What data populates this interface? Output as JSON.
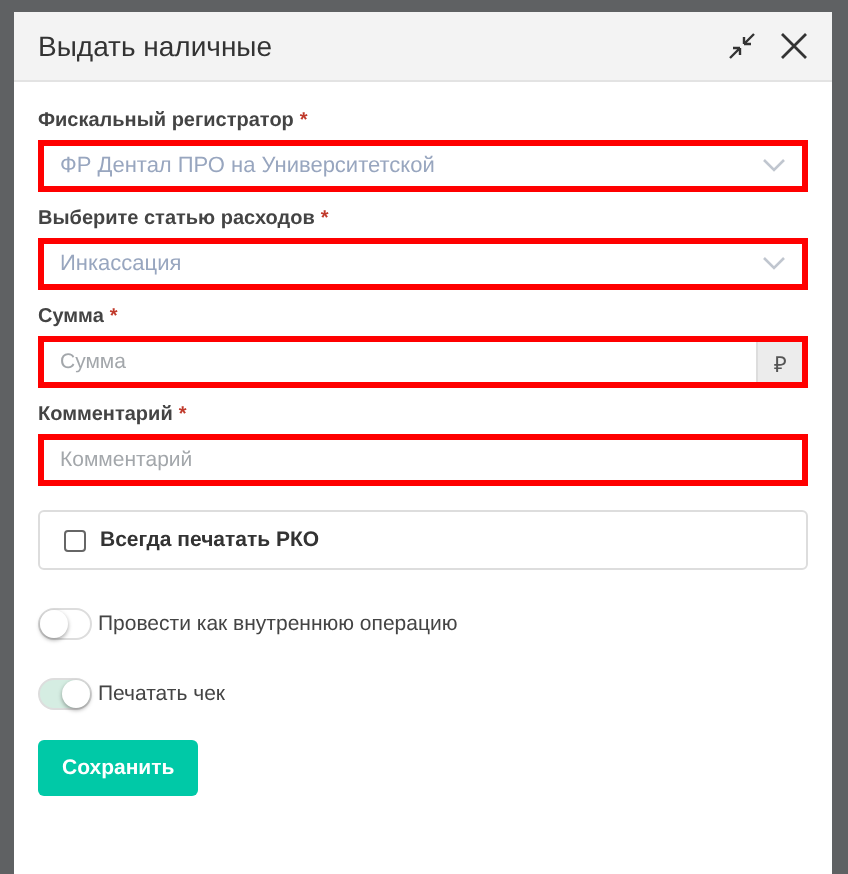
{
  "dialog": {
    "title": "Выдать наличные"
  },
  "fields": [
    {
      "kind": "select",
      "label": "Фискальный регистратор",
      "required_mark": "*",
      "value": "ФР Дентал ПРО на Университетской",
      "highlighted": true
    },
    {
      "kind": "select",
      "label": "Выберите статью расходов",
      "required_mark": "*",
      "value": "Инкассация",
      "highlighted": true
    },
    {
      "kind": "money",
      "label": "Сумма",
      "required_mark": "*",
      "placeholder": "Сумма",
      "suffix": "₽",
      "highlighted": true
    },
    {
      "kind": "text",
      "label": "Комментарий",
      "required_mark": "*",
      "placeholder": "Комментарий",
      "highlighted": true
    }
  ],
  "checkbox": {
    "label": "Всегда печатать РКО",
    "checked": false
  },
  "toggles": [
    {
      "label": "Провести как внутреннюю операцию",
      "on": false
    },
    {
      "label": "Печатать чек",
      "on": true
    }
  ],
  "save_button": "Сохранить"
}
